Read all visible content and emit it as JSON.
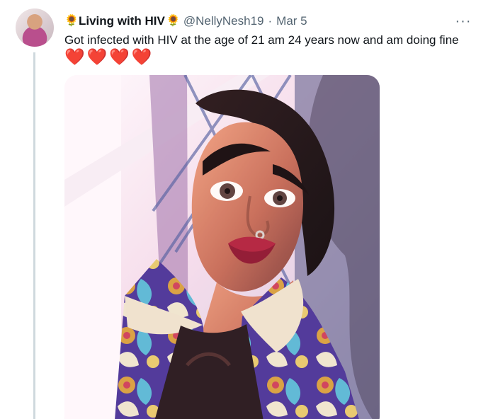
{
  "tweet": {
    "author_name": "Living with HIV",
    "author_handle": "@NellyNesh19",
    "separator": "·",
    "date": "Mar 5",
    "more_label": "···",
    "text": "Got infected with HIV at the age of 21 am 24 years now and am doing fine",
    "hearts": [
      "❤️",
      "❤️",
      "❤️",
      "❤️"
    ],
    "emoji": "🌻"
  },
  "icons": {
    "name_decoration": "sunflower-icon",
    "more": "more-options-icon",
    "heart": "heart-icon"
  },
  "colors": {
    "text": "#0f1419",
    "secondary_text": "#536471",
    "thread_line": "#cfd9de",
    "heart": "#e1192b"
  }
}
